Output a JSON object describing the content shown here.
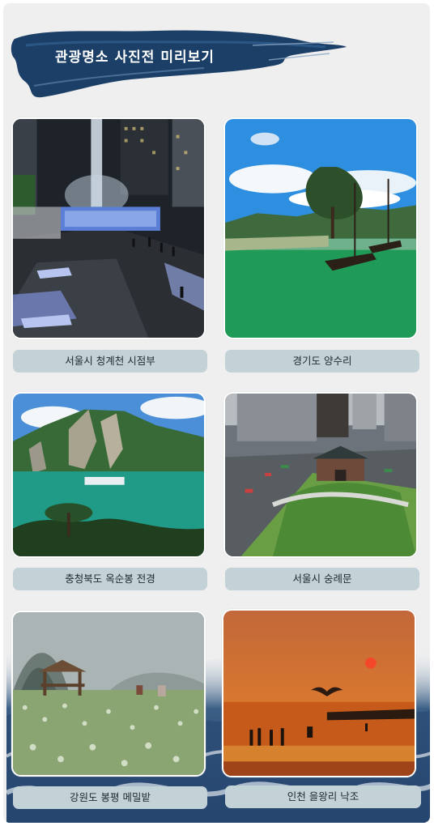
{
  "header": {
    "title": "관광명소 사진전 미리보기"
  },
  "gallery": {
    "items": [
      {
        "caption": "서울시 청계천 시점부"
      },
      {
        "caption": "경기도 양수리"
      },
      {
        "caption": "충청북도 옥순봉 전경"
      },
      {
        "caption": "서울시 숭례문"
      },
      {
        "caption": "강원도 봉평 메밀밭"
      },
      {
        "caption": "인천 을왕리 낙조"
      }
    ]
  },
  "colors": {
    "panel_bg": "#efefef",
    "brush_navy": "#1b3f66",
    "caption_bg": "#c3d2d6",
    "caption_text": "#1e2b30"
  }
}
